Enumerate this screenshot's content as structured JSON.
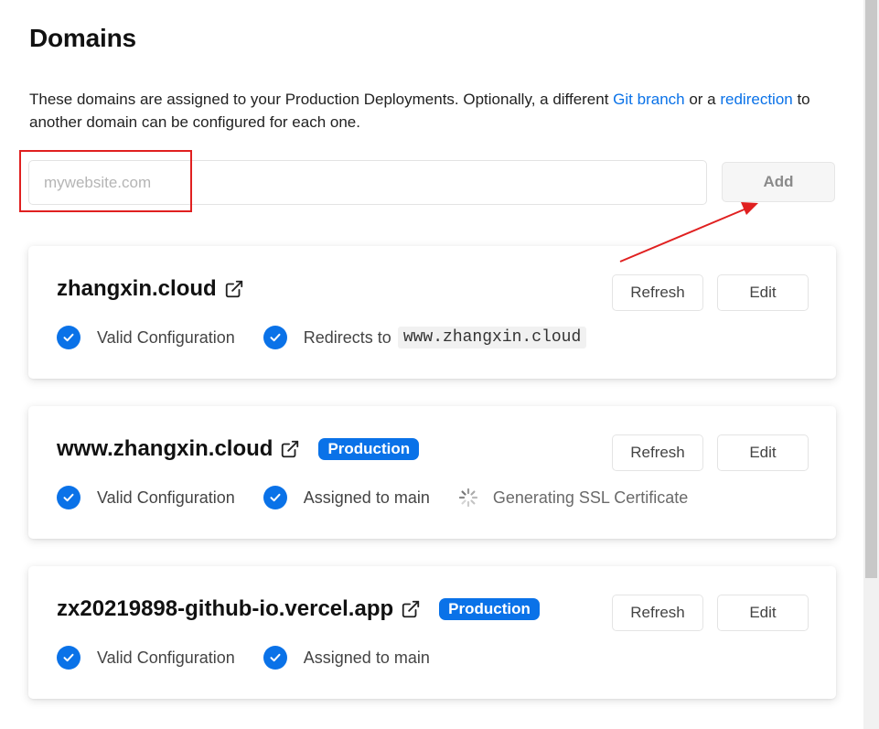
{
  "header": {
    "title": "Domains",
    "description_part1": "These domains are assigned to your Production Deployments. Optionally, a different ",
    "link_git_branch": "Git branch",
    "description_part2": " or a ",
    "link_redirection": "redirection",
    "description_part3": " to another domain can be configured for each one."
  },
  "add_domain": {
    "input_value": "",
    "input_placeholder": "mywebsite.com",
    "add_label": "Add"
  },
  "domains": [
    {
      "name": "zhangxin.cloud",
      "badge": "",
      "refresh_label": "Refresh",
      "edit_label": "Edit",
      "status_valid": "Valid Configuration",
      "status_second": "Redirects to",
      "redirect_target": "www.zhangxin.cloud"
    },
    {
      "name": "www.zhangxin.cloud",
      "badge": "Production",
      "refresh_label": "Refresh",
      "edit_label": "Edit",
      "status_valid": "Valid Configuration",
      "status_second": "Assigned to main",
      "status_third": "Generating SSL Certificate"
    },
    {
      "name": "zx20219898-github-io.vercel.app",
      "badge": "Production",
      "refresh_label": "Refresh",
      "edit_label": "Edit",
      "status_valid": "Valid Configuration",
      "status_second": "Assigned to main"
    }
  ],
  "icons": {
    "external_link": "external-link-icon",
    "check": "check-circle-icon",
    "spinner": "spinner-icon"
  },
  "colors": {
    "accent": "#0a72e8",
    "annotation_red": "#e02020"
  }
}
